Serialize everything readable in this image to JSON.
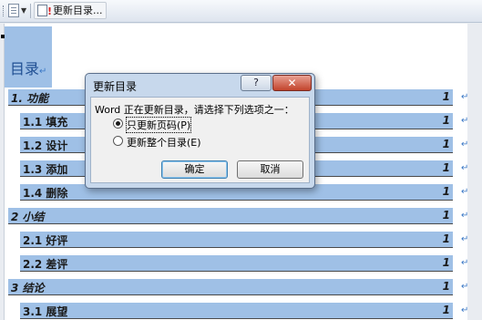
{
  "toolbar": {
    "toc_update_label": "更新目录..."
  },
  "document": {
    "title": "目录",
    "para_mark": "↵",
    "toc": [
      {
        "text": "1. 功能",
        "page": "1",
        "level": 1
      },
      {
        "text": "1.1 填充",
        "page": "1",
        "level": 2
      },
      {
        "text": "1.2 设计",
        "page": "1",
        "level": 2
      },
      {
        "text": "1.3 添加",
        "page": "1",
        "level": 2
      },
      {
        "text": "1.4 删除",
        "page": "1",
        "level": 2
      },
      {
        "text": "2 小结",
        "page": "1",
        "level": 1
      },
      {
        "text": "2.1 好评",
        "page": "1",
        "level": 2
      },
      {
        "text": "2.2 差评",
        "page": "1",
        "level": 2
      },
      {
        "text": "3 结论",
        "page": "1",
        "level": 1
      },
      {
        "text": "3.1 展望",
        "page": "1",
        "level": 2
      }
    ]
  },
  "dialog": {
    "title": "更新目录",
    "help_label": "?",
    "close_label": "✕",
    "prompt": "Word 正在更新目录，请选择下列选项之一：",
    "options": [
      {
        "label": "只更新页码(P)",
        "selected": true
      },
      {
        "label": "更新整个目录(E)",
        "selected": false
      }
    ],
    "ok_label": "确定",
    "cancel_label": "取消"
  }
}
